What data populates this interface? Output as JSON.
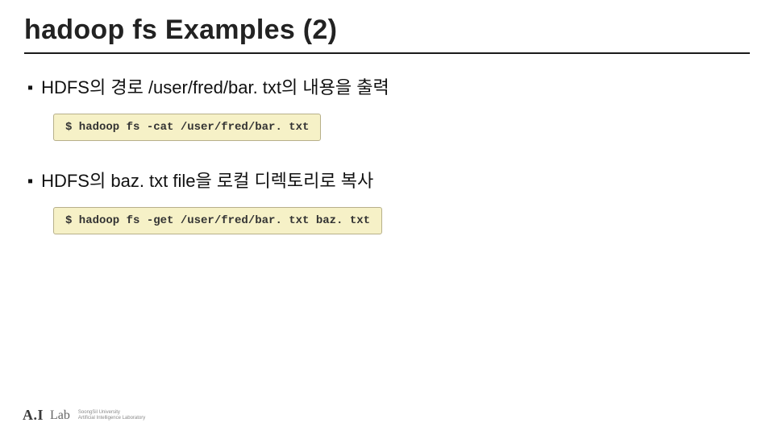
{
  "title": "hadoop fs Examples (2)",
  "sections": [
    {
      "bullet": "▪",
      "text_prefix": "HDFS의 경로 ",
      "path": "/user/fred/bar. txt",
      "text_suffix": "의 내용을 출력",
      "code": "$ hadoop fs -cat /user/fred/bar. txt"
    },
    {
      "bullet": "▪",
      "text_prefix": "HDFS의 ",
      "path": "baz. txt file",
      "text_suffix": "을 로컬 디렉토리로 복사",
      "code": "$ hadoop fs -get /user/fred/bar. txt baz. txt"
    }
  ],
  "footer": {
    "logo_main": "A.I",
    "logo_lab": "Lab",
    "sub1": "SoongSil University",
    "sub2": "Artificial Intelligence Laboratory"
  }
}
